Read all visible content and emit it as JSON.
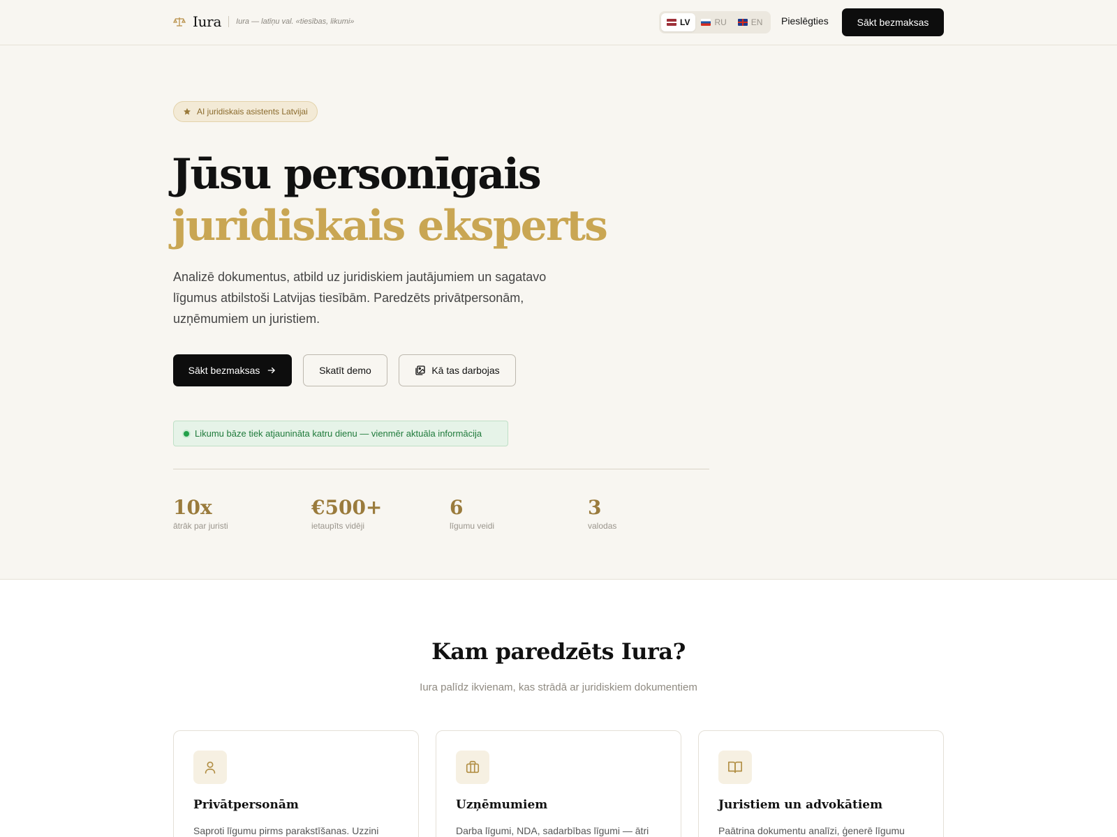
{
  "header": {
    "logo_name": "Iura",
    "logo_tagline": "Iura — latīņu val. «tiesības, likumi»",
    "languages": [
      {
        "code": "LV",
        "flag": "latvia-flag",
        "active": true
      },
      {
        "code": "RU",
        "flag": "russia-flag",
        "active": false
      },
      {
        "code": "EN",
        "flag": "uk-flag",
        "active": false
      }
    ],
    "login_label": "Pieslēgties",
    "cta_label": "Sākt bezmaksas"
  },
  "hero": {
    "badge": "AI juridiskais asistents Latvijai",
    "title_line1": "Jūsu personīgais",
    "title_line2": "juridiskais eksperts",
    "description": "Analizē dokumentus, atbild uz juridiskiem jautājumiem un sagatavo līgumus atbilstoši Latvijas tiesībām. Paredzēts privātpersonām, uzņēmumiem un juristiem.",
    "buttons": {
      "primary": "Sākt bezmaksas",
      "demo": "Skatīt demo",
      "how": "Kā tas darbojas"
    },
    "notice": "Likumu bāze tiek atjaunināta katru dienu — vienmēr aktuāla informācija",
    "stats": [
      {
        "value": "10x",
        "label": "ātrāk par juristi"
      },
      {
        "value": "€500+",
        "label": "ietaupīts vidēji"
      },
      {
        "value": "6",
        "label": "līgumu veidi"
      },
      {
        "value": "3",
        "label": "valodas"
      }
    ]
  },
  "audience": {
    "title": "Kam paredzēts Iura?",
    "subtitle": "Iura palīdz ikvienam, kas strādā ar juridiskiem dokumentiem",
    "cards": [
      {
        "icon": "user-icon",
        "title": "Privātpersonām",
        "text": "Saproti līgumu pirms parakstīšanas. Uzzini"
      },
      {
        "icon": "briefcase-icon",
        "title": "Uzņēmumiem",
        "text": "Darba līgumi, NDA, sadarbības līgumi — ātri"
      },
      {
        "icon": "book-icon",
        "title": "Juristiem un advokātiem",
        "text": "Paātrina dokumentu analīzi, ģenerē līgumu"
      }
    ]
  },
  "colors": {
    "accent_gold": "#c9a653",
    "stat_gold": "#9a7b3c",
    "primary_dark": "#0d0d0d",
    "hero_bg": "#f8f6f1",
    "notice_green": "#1f7a3b"
  }
}
